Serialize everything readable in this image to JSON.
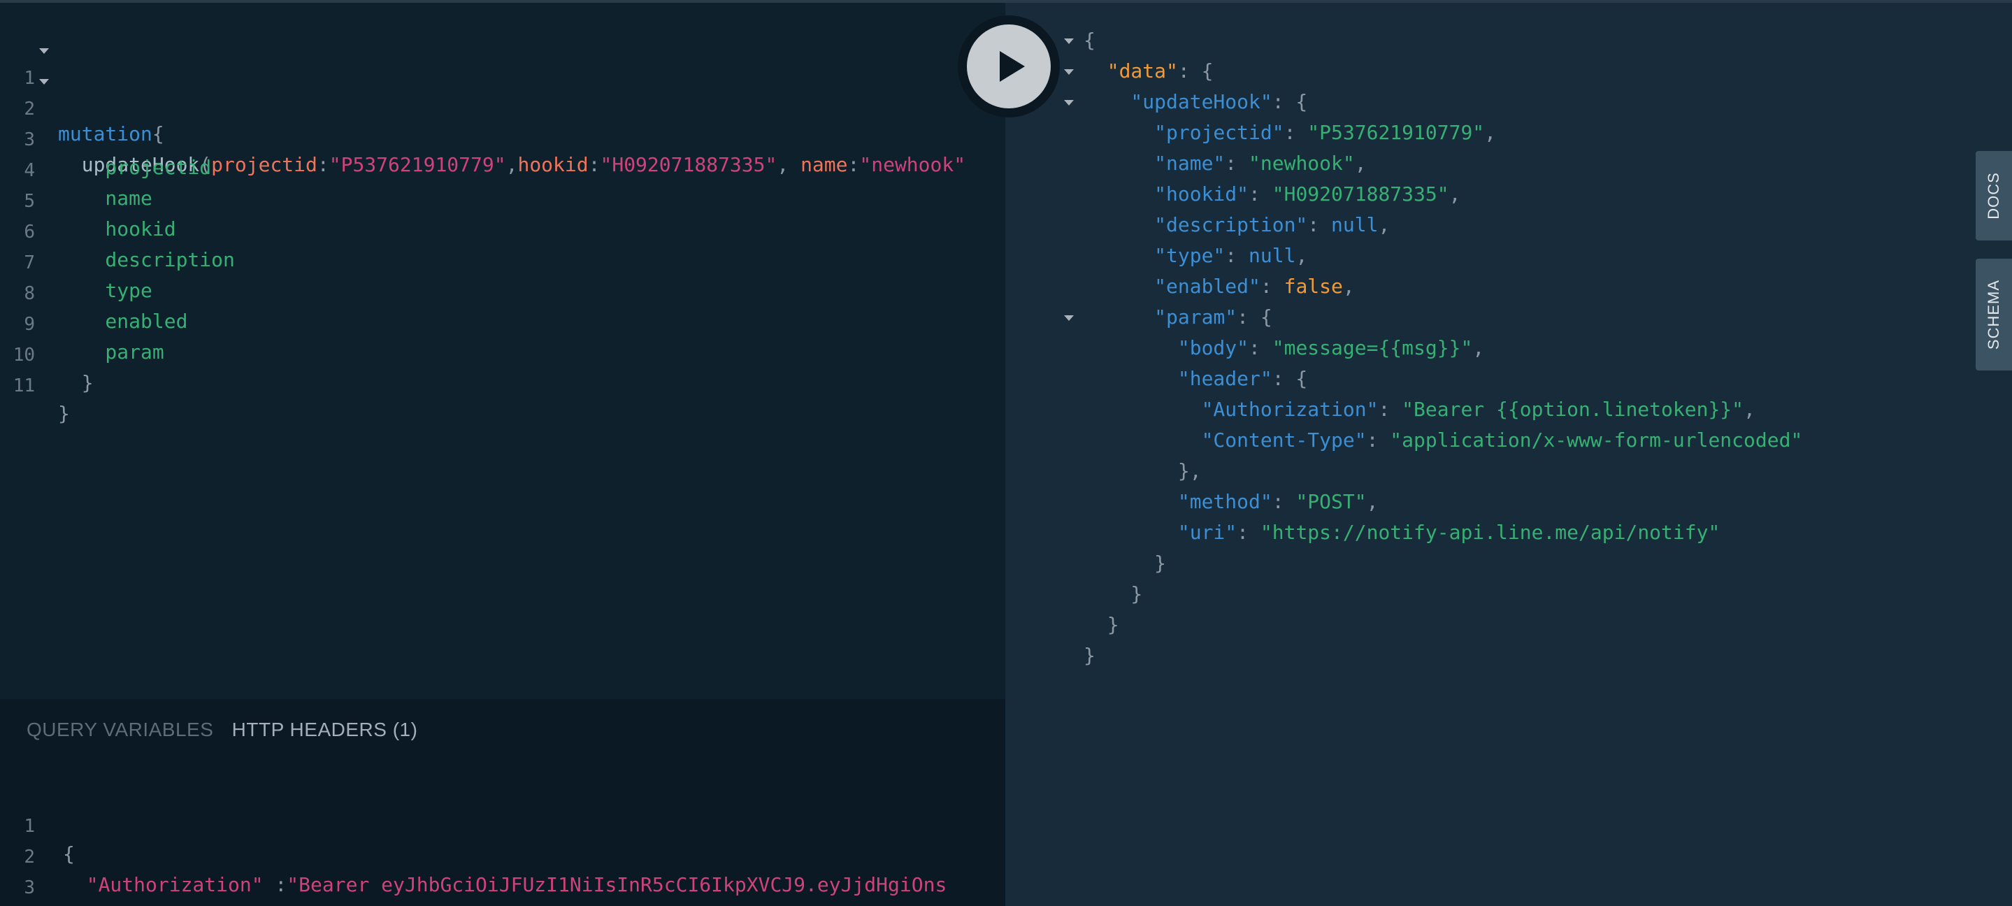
{
  "editor": {
    "lines": [
      {
        "n": "1",
        "parts": [
          {
            "t": "mutation",
            "c": "kw"
          },
          {
            "t": "{",
            "c": "punc"
          }
        ]
      },
      {
        "n": "2",
        "parts": [
          {
            "t": "  updateHook",
            "c": "fn"
          },
          {
            "t": "(",
            "c": "punc"
          },
          {
            "t": "projectid",
            "c": "arg"
          },
          {
            "t": ":",
            "c": "punc"
          },
          {
            "t": "\"P537621910779\"",
            "c": "str"
          },
          {
            "t": ",",
            "c": "punc"
          },
          {
            "t": "hookid",
            "c": "arg"
          },
          {
            "t": ":",
            "c": "punc"
          },
          {
            "t": "\"H092071887335\"",
            "c": "str"
          },
          {
            "t": ", ",
            "c": "punc"
          },
          {
            "t": "name",
            "c": "arg"
          },
          {
            "t": ":",
            "c": "punc"
          },
          {
            "t": "\"newhook\"",
            "c": "str"
          }
        ]
      },
      {
        "n": "3",
        "parts": [
          {
            "t": "    projectid",
            "c": "fld"
          }
        ]
      },
      {
        "n": "4",
        "parts": [
          {
            "t": "    name",
            "c": "fld"
          }
        ]
      },
      {
        "n": "5",
        "parts": [
          {
            "t": "    hookid",
            "c": "fld"
          }
        ]
      },
      {
        "n": "6",
        "parts": [
          {
            "t": "    description",
            "c": "fld"
          }
        ]
      },
      {
        "n": "7",
        "parts": [
          {
            "t": "    type",
            "c": "fld"
          }
        ]
      },
      {
        "n": "8",
        "parts": [
          {
            "t": "    enabled",
            "c": "fld"
          }
        ]
      },
      {
        "n": "9",
        "parts": [
          {
            "t": "    param",
            "c": "fld"
          }
        ]
      },
      {
        "n": "10",
        "parts": [
          {
            "t": "  }",
            "c": "punc"
          }
        ]
      },
      {
        "n": "11",
        "parts": [
          {
            "t": "}",
            "c": "punc"
          }
        ]
      }
    ]
  },
  "variables": {
    "tabs": [
      "QUERY VARIABLES",
      "HTTP HEADERS (1)"
    ],
    "lines": [
      {
        "n": "1",
        "parts": [
          {
            "t": "{",
            "c": "punc"
          }
        ]
      },
      {
        "n": "2",
        "parts": [
          {
            "t": "  \"Authorization\"",
            "c": "str"
          },
          {
            "t": " :",
            "c": "punc"
          },
          {
            "t": "\"Bearer eyJhbGciOiJFUzI1NiIsInR5cCI6IkpXVCJ9.eyJjdHgiOns",
            "c": "str"
          }
        ]
      },
      {
        "n": "3",
        "parts": [
          {
            "t": "}",
            "c": "punc"
          }
        ]
      }
    ]
  },
  "result": {
    "lines": [
      {
        "parts": [
          {
            "t": "{",
            "c": "rp"
          }
        ]
      },
      {
        "parts": [
          {
            "t": "  \"data\"",
            "c": "rdata"
          },
          {
            "t": ": {",
            "c": "rp"
          }
        ]
      },
      {
        "parts": [
          {
            "t": "    \"updateHook\"",
            "c": "rkey"
          },
          {
            "t": ": {",
            "c": "rp"
          }
        ]
      },
      {
        "parts": [
          {
            "t": "      \"projectid\"",
            "c": "rkey"
          },
          {
            "t": ": ",
            "c": "rp"
          },
          {
            "t": "\"P537621910779\"",
            "c": "rstr"
          },
          {
            "t": ",",
            "c": "rp"
          }
        ]
      },
      {
        "parts": [
          {
            "t": "      \"name\"",
            "c": "rkey"
          },
          {
            "t": ": ",
            "c": "rp"
          },
          {
            "t": "\"newhook\"",
            "c": "rstr"
          },
          {
            "t": ",",
            "c": "rp"
          }
        ]
      },
      {
        "parts": [
          {
            "t": "      \"hookid\"",
            "c": "rkey"
          },
          {
            "t": ": ",
            "c": "rp"
          },
          {
            "t": "\"H092071887335\"",
            "c": "rstr"
          },
          {
            "t": ",",
            "c": "rp"
          }
        ]
      },
      {
        "parts": [
          {
            "t": "      \"description\"",
            "c": "rkey"
          },
          {
            "t": ": ",
            "c": "rp"
          },
          {
            "t": "null",
            "c": "rnull"
          },
          {
            "t": ",",
            "c": "rp"
          }
        ]
      },
      {
        "parts": [
          {
            "t": "      \"type\"",
            "c": "rkey"
          },
          {
            "t": ": ",
            "c": "rp"
          },
          {
            "t": "null",
            "c": "rnull"
          },
          {
            "t": ",",
            "c": "rp"
          }
        ]
      },
      {
        "parts": [
          {
            "t": "      \"enabled\"",
            "c": "rkey"
          },
          {
            "t": ": ",
            "c": "rp"
          },
          {
            "t": "false",
            "c": "rfalse"
          },
          {
            "t": ",",
            "c": "rp"
          }
        ]
      },
      {
        "parts": [
          {
            "t": "      \"param\"",
            "c": "rkey"
          },
          {
            "t": ": {",
            "c": "rp"
          }
        ]
      },
      {
        "parts": [
          {
            "t": "        \"body\"",
            "c": "rkey"
          },
          {
            "t": ": ",
            "c": "rp"
          },
          {
            "t": "\"message={{msg}}\"",
            "c": "rstr"
          },
          {
            "t": ",",
            "c": "rp"
          }
        ]
      },
      {
        "parts": [
          {
            "t": "        \"header\"",
            "c": "rkey"
          },
          {
            "t": ": {",
            "c": "rp"
          }
        ]
      },
      {
        "parts": [
          {
            "t": "          \"Authorization\"",
            "c": "rkey"
          },
          {
            "t": ": ",
            "c": "rp"
          },
          {
            "t": "\"Bearer {{option.linetoken}}\"",
            "c": "rstr"
          },
          {
            "t": ",",
            "c": "rp"
          }
        ]
      },
      {
        "parts": [
          {
            "t": "          \"Content-Type\"",
            "c": "rkey"
          },
          {
            "t": ": ",
            "c": "rp"
          },
          {
            "t": "\"application/x-www-form-urlencoded\"",
            "c": "rstr"
          }
        ]
      },
      {
        "parts": [
          {
            "t": "        },",
            "c": "rp"
          }
        ]
      },
      {
        "parts": [
          {
            "t": "        \"method\"",
            "c": "rkey"
          },
          {
            "t": ": ",
            "c": "rp"
          },
          {
            "t": "\"POST\"",
            "c": "rstr"
          },
          {
            "t": ",",
            "c": "rp"
          }
        ]
      },
      {
        "parts": [
          {
            "t": "        \"uri\"",
            "c": "rkey"
          },
          {
            "t": ": ",
            "c": "rp"
          },
          {
            "t": "\"https://notify-api.line.me/api/notify\"",
            "c": "rstr"
          }
        ]
      },
      {
        "parts": [
          {
            "t": "      }",
            "c": "rp"
          }
        ]
      },
      {
        "parts": [
          {
            "t": "    }",
            "c": "rp"
          }
        ]
      },
      {
        "parts": [
          {
            "t": "  }",
            "c": "rp"
          }
        ]
      },
      {
        "parts": [
          {
            "t": "}",
            "c": "rp"
          }
        ]
      }
    ]
  },
  "side_tabs": {
    "docs": "DOCS",
    "schema": "SCHEMA"
  },
  "icons": {
    "run": "play-icon",
    "fold": "chevron-down-icon"
  },
  "colors": {
    "editor_bg": "#0f202d",
    "result_bg": "#172b3a",
    "keyword": "#3c8fd4",
    "string": "#d0427a",
    "argument": "#f0745a",
    "field": "#37b073",
    "json_string": "#37b073",
    "json_bool": "#f29a35"
  }
}
